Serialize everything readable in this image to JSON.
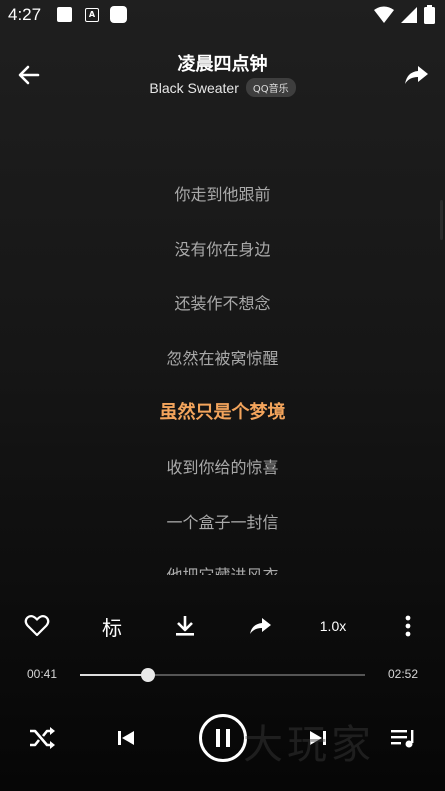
{
  "status_bar": {
    "time": "4:27",
    "icons": [
      "notification-square-icon",
      "font-app-icon",
      "app-square-icon",
      "wifi-icon",
      "signal-icon",
      "battery-icon"
    ]
  },
  "header": {
    "title": "凌晨四点钟",
    "artist": "Black Sweater",
    "source": "QQ音乐",
    "icons": [
      "back-arrow-icon",
      "share-icon"
    ]
  },
  "lyrics": {
    "lines": [
      "你走到他跟前",
      "没有你在身边",
      "还装作不想念",
      "忽然在被窝惊醒",
      "虽然只是个梦境",
      "收到你给的惊喜",
      "一个盒子一封信",
      "他把它藏进风衣"
    ],
    "current_index": 4,
    "current_color": "#f3a45c"
  },
  "actions": {
    "mark_label": "标",
    "speed_label": "1.0x",
    "icons": [
      "heart-icon",
      "download-icon",
      "share-icon",
      "more-vertical-icon"
    ]
  },
  "progress": {
    "current_time": "00:41",
    "total_time": "02:52",
    "fraction": 0.24
  },
  "controls": {
    "icons": [
      "shuffle-icon",
      "previous-icon",
      "pause-icon",
      "next-icon",
      "playlist-icon"
    ]
  },
  "watermark": {
    "text": "大玩家"
  }
}
